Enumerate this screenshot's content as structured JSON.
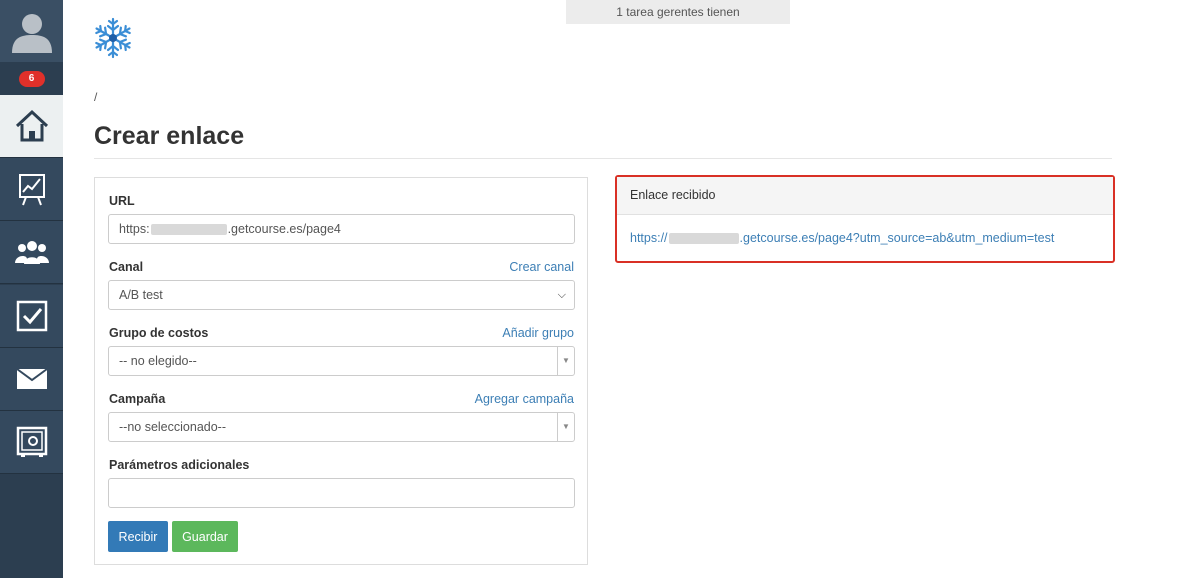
{
  "notice": {
    "text": "1 tarea gerentes tienen"
  },
  "sidebar": {
    "badge_count": "6",
    "items": [
      {
        "icon": "home-icon",
        "active": true
      },
      {
        "icon": "chart-icon",
        "active": false
      },
      {
        "icon": "users-icon",
        "active": false
      },
      {
        "icon": "checkbox-icon",
        "active": false
      },
      {
        "icon": "mail-icon",
        "active": false
      },
      {
        "icon": "safe-icon",
        "active": false
      }
    ]
  },
  "breadcrumb": "/",
  "page_title": "Crear enlace",
  "form": {
    "url_label": "URL",
    "url_prefix": "https:",
    "url_suffix": ".getcourse.es/page4",
    "channel_label": "Canal",
    "channel_link": "Crear canal",
    "channel_value": "A/B test",
    "cost_group_label": "Grupo de costos",
    "cost_group_link": "Añadir grupo",
    "cost_group_value": "-- no elegido--",
    "campaign_label": "Campaña",
    "campaign_link": "Agregar campaña",
    "campaign_value": "--no seleccionado--",
    "extra_params_label": "Parámetros adicionales",
    "extra_params_value": "",
    "receive_button": "Recibir",
    "save_button": "Guardar"
  },
  "result": {
    "header": "Enlace recibido",
    "link_prefix": "https://",
    "link_suffix": ".getcourse.es/page4?utm_source=ab&utm_medium=test"
  },
  "colors": {
    "sidebar": "#2c3e50",
    "link": "#3d7fb5",
    "primary_button": "#337ab7",
    "success_button": "#5cb85c",
    "highlight_border": "#d93025",
    "badge": "#e0302a"
  }
}
